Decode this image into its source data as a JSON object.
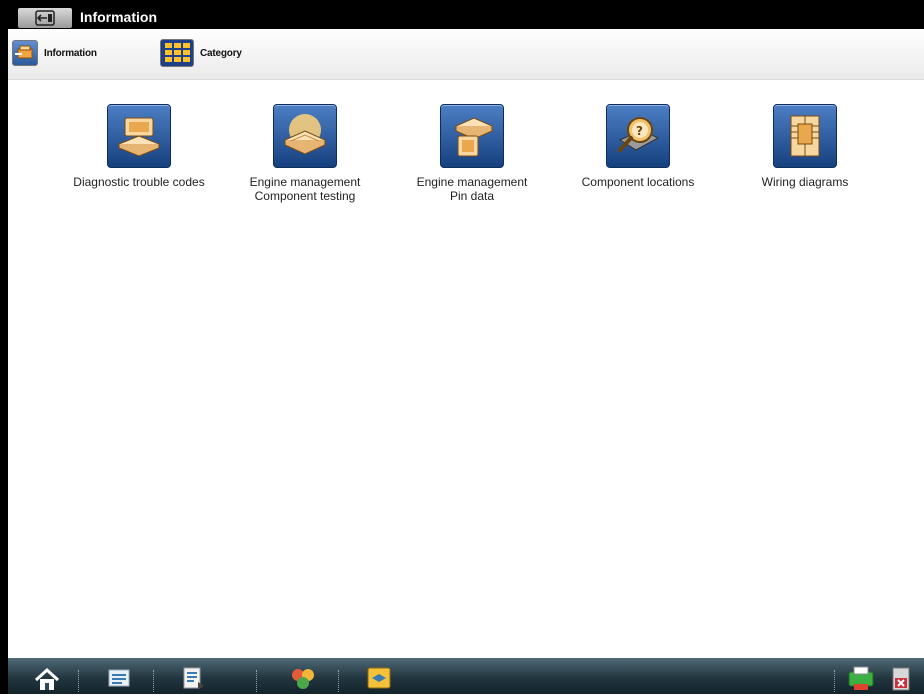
{
  "window": {
    "title": "Information"
  },
  "toolbar": {
    "information_label": "Information",
    "category_label": "Category"
  },
  "tiles": [
    {
      "label": "Diagnostic trouble codes",
      "icon": "dtc-icon"
    },
    {
      "label": "Engine management\nComponent testing",
      "icon": "component-testing-icon"
    },
    {
      "label": "Engine management\nPin data",
      "icon": "pin-data-icon"
    },
    {
      "label": "Component locations",
      "icon": "component-locations-icon"
    },
    {
      "label": "Wiring diagrams",
      "icon": "wiring-diagrams-icon"
    }
  ],
  "taskbar": {
    "items": [
      "home-icon",
      "vehicle-id-icon",
      "checklist-icon",
      "tools-icon",
      "information-icon",
      "print-icon",
      "exit-icon"
    ]
  },
  "colors": {
    "accent": "#1f4f94",
    "titlebar": "#000000",
    "taskbar": "#233640"
  }
}
